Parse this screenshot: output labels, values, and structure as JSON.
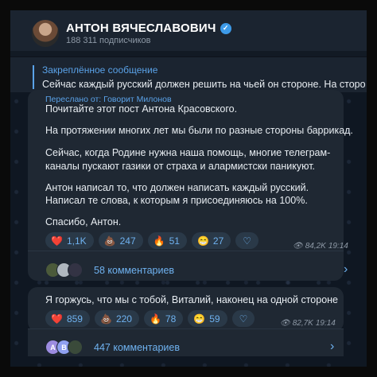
{
  "channel": {
    "title": "АНТОН ВЯЧЕСЛАВОВИЧ",
    "subscribers": "188 311 подписчиков"
  },
  "pinned": {
    "title": "Закреплённое сообщение",
    "text": "Сейчас каждый русский должен решить на чьей он стороне.  На сторо"
  },
  "post1": {
    "forwarded": "Переслано от: Говорит Милонов",
    "lines": [
      "Почитайте этот пост Антона Красовского.",
      "На протяжении многих лет мы были по разные стороны баррикад.",
      "Сейчас, когда Родине нужна наша помощь, многие телеграм-",
      "каналы пускают газики от страха и алармистски паникуют.",
      "Антон написал то, что должен написать каждый русский.",
      "Написал те слова, к которым я присоединяюсь на 100%.",
      "Спасибо, Антон."
    ],
    "reactions": [
      {
        "emoji": "❤️",
        "count": "1,1K"
      },
      {
        "emoji": "💩",
        "count": "247"
      },
      {
        "emoji": "🔥",
        "count": "51"
      },
      {
        "emoji": "😁",
        "count": "27"
      }
    ],
    "views": "84,2K",
    "time": "19:14",
    "comments": "58 комментариев"
  },
  "post2": {
    "text": "Я горжусь, что мы с тобой, Виталий, наконец на одной стороне",
    "reactions": [
      {
        "emoji": "❤️",
        "count": "859"
      },
      {
        "emoji": "💩",
        "count": "220"
      },
      {
        "emoji": "🔥",
        "count": "78"
      },
      {
        "emoji": "😁",
        "count": "59"
      }
    ],
    "views": "82,7K",
    "time": "19:14",
    "comments": "447 комментариев",
    "commenter_initials": [
      "A",
      "B"
    ]
  },
  "colors": {
    "accent": "#5aa2e8",
    "bubble": "#1f2833",
    "header": "#1b2430"
  }
}
